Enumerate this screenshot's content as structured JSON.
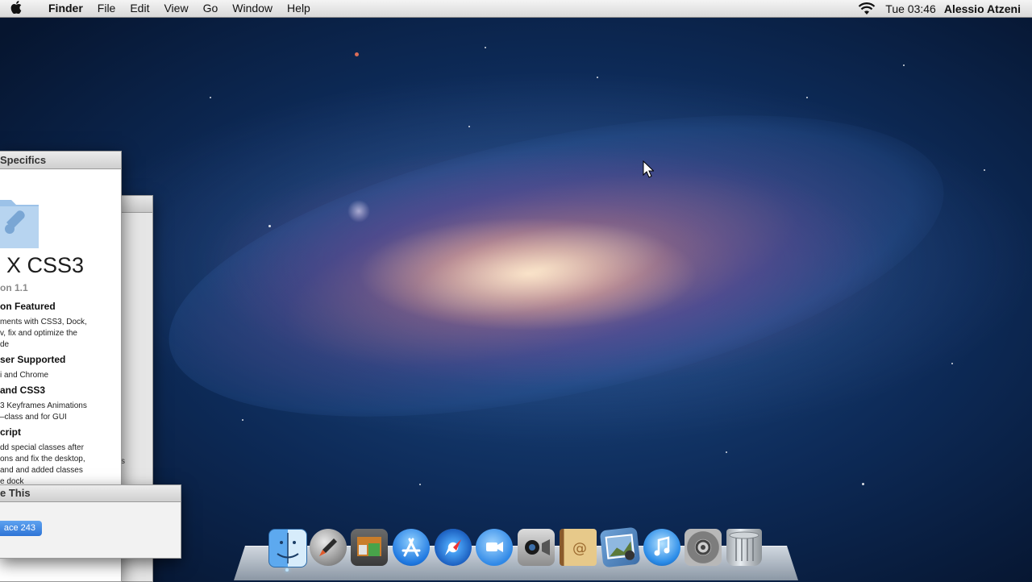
{
  "menubar": {
    "apple_icon": "apple-icon",
    "app_name": "Finder",
    "items": [
      "File",
      "Edit",
      "View",
      "Go",
      "Window",
      "Help"
    ],
    "clock": "Tue 03:46",
    "user": "Alessio Atzeni"
  },
  "specifics_window": {
    "title": "Specifics",
    "app_title": "X CSS3",
    "version": "on 1.1",
    "sections": [
      {
        "heading": "on Featured",
        "lines": [
          "ments with CSS3, Dock,",
          "v, fix and optimize the",
          "de"
        ]
      },
      {
        "heading": "ser Supported",
        "lines": [
          "i and Chrome"
        ]
      },
      {
        "heading": "and CSS3",
        "lines": [
          "3 Keyframes Animations",
          "–class and for GUI"
        ]
      },
      {
        "heading": "cript",
        "lines": [
          "dd special classes after",
          "ons and fix the desktop,",
          " and and added classes",
          "e dock"
        ]
      }
    ]
  },
  "back_window": {
    "fragment": "s"
  },
  "dialog": {
    "title": "e This",
    "button_label": "ace 243"
  },
  "dock": {
    "icons": [
      "finder-icon",
      "launchpad-icon",
      "photo-booth-icon",
      "app-store-icon",
      "safari-icon",
      "ichat-icon",
      "facetime-icon",
      "address-book-icon",
      "iphoto-icon",
      "itunes-icon",
      "system-preferences-icon",
      "trash-icon"
    ]
  },
  "colors": {
    "accent": "#2e74d6",
    "desktop": "#0d2a57"
  }
}
